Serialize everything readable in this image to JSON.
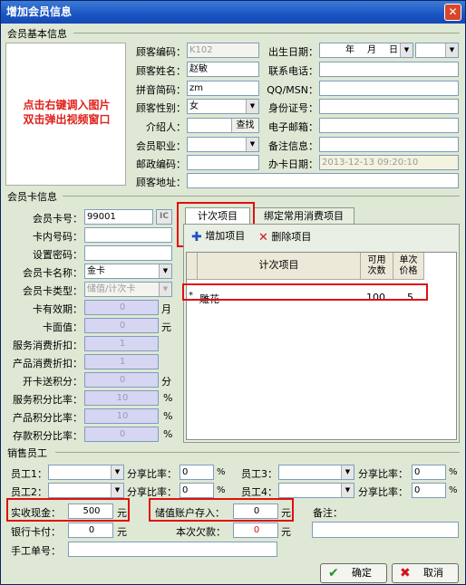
{
  "window": {
    "title": "增加会员信息",
    "close": "✕"
  },
  "sections": {
    "basic": "会员基本信息",
    "card": "会员卡信息",
    "staff": "销售员工"
  },
  "photo": {
    "line1": "点击右键调入图片",
    "line2": "双击弹出视频窗口"
  },
  "basic": {
    "code_label": "顾客编码：",
    "code_value": "K102",
    "name_label": "顾客姓名：",
    "name_value": "赵敏",
    "pinyin_label": "拼音简码：",
    "pinyin_value": "zm",
    "gender_label": "顾客性别：",
    "gender_value": "女",
    "referrer_label": "介绍人：",
    "find_label": "查找",
    "job_label": "会员职业：",
    "zip_label": "邮政编码：",
    "address_label": "顾客地址：",
    "birthday_label": "出生日期：",
    "year": "年",
    "month": "月",
    "day": "日",
    "phone_label": "联系电话：",
    "qq_label": "QQ/MSN：",
    "id_label": "身份证号：",
    "email_label": "电子邮箱：",
    "note_label": "备注信息：",
    "issue_label": "办卡日期：",
    "issue_value": "2013-12-13 09:20:10"
  },
  "card": {
    "card_no_label": "会员卡号：",
    "card_no_value": "99001",
    "ic": "IC",
    "inner_no_label": "卡内号码：",
    "pwd_label": "设置密码：",
    "name_label": "会员卡名称：",
    "name_value": "金卡",
    "type_label": "会员卡类型：",
    "type_value": "储值/计次卡",
    "valid_label": "卡有效期：",
    "valid_value": "0",
    "valid_unit": "月",
    "face_label": "卡面值：",
    "face_value": "0",
    "face_unit": "元",
    "svc_disc_label": "服务消费折扣：",
    "svc_disc_value": "1",
    "prod_disc_label": "产品消费折扣：",
    "prod_disc_value": "1",
    "bonus_label": "开卡送积分：",
    "bonus_value": "0",
    "bonus_unit": "分",
    "svc_pts_label": "服务积分比率：",
    "svc_pts_value": "10",
    "svc_pts_unit": "%",
    "prod_pts_label": "产品积分比率：",
    "prod_pts_value": "10",
    "prod_pts_unit": "%",
    "dep_pts_label": "存款积分比率：",
    "dep_pts_value": "0",
    "dep_pts_unit": "%"
  },
  "tabs": {
    "t1": "计次项目",
    "t2": "绑定常用消费项目"
  },
  "toolbar": {
    "add": "增加项目",
    "del": "删除项目"
  },
  "grid": {
    "col_item": "计次项目",
    "col_avail_1": "可用",
    "col_avail_2": "次数",
    "col_price_1": "单次",
    "col_price_2": "价格",
    "row_marker": "*",
    "row_item": "雕花",
    "row_avail": "100",
    "row_price": "5"
  },
  "staff": {
    "e1": "员工1：",
    "e2": "员工2：",
    "e3": "员工3：",
    "e4": "员工4：",
    "share": "分享比率：",
    "pct": "%",
    "s1": "0",
    "s2": "0",
    "s3": "0",
    "s4": "0"
  },
  "payment": {
    "cash_label": "实收现金：",
    "cash_value": "500",
    "cash_unit": "元",
    "deposit_label": "储值账户存入：",
    "deposit_value": "0",
    "deposit_unit": "元",
    "note_label": "备注：",
    "bank_label": "银行卡付：",
    "bank_value": "0",
    "bank_unit": "元",
    "debt_label": "本次欠款：",
    "debt_value": "0",
    "debt_unit": "元",
    "manual_label": "手工单号："
  },
  "buttons": {
    "ok": "确定",
    "cancel": "取消"
  },
  "colors": {
    "highlight": "#e01010",
    "titlebar": "#1a55c4",
    "form_bg": "#dfe8d4"
  }
}
